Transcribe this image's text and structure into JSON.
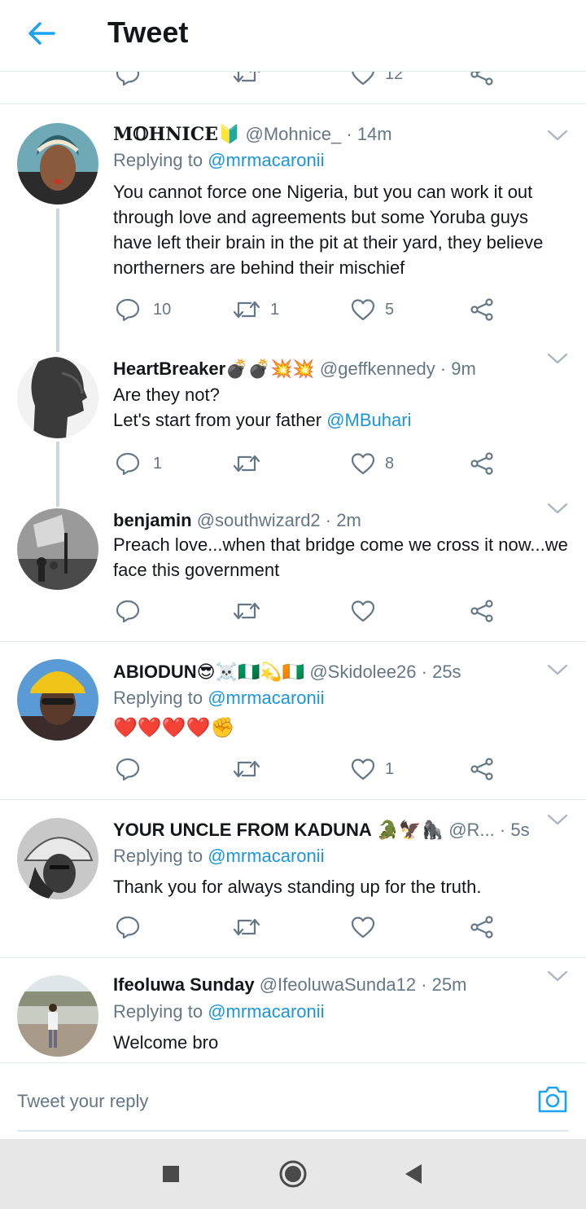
{
  "header": {
    "title": "Tweet"
  },
  "partial": {
    "like_count": "12"
  },
  "tweets": [
    {
      "name": "M𝕆HNICE",
      "name_emoji": "🔰",
      "handle": "@Mohnice_",
      "time": "· 14m",
      "replying_prefix": "Replying to",
      "replying_to": "@mrmacaronii",
      "text": "You cannot force one Nigeria, but you can work it out through love and agreements but some Yoruba guys have left their brain in the pit at their yard, they believe northerners are behind their mischief",
      "reply_count": "10",
      "retweet_count": "1",
      "like_count": "5"
    },
    {
      "name": "HeartBreaker",
      "name_emoji": "💣💣💥💥",
      "handle": "@geffkennedy",
      "time": "· 9m",
      "text_line1": "Are they not?",
      "text_line2_prefix": "Let's start from your father",
      "text_line2_mention": "@MBuhari",
      "reply_count": "1",
      "retweet_count": "",
      "like_count": "8"
    },
    {
      "name": "benjamin",
      "handle": "@southwizard2",
      "time": "· 2m",
      "text": "Preach love...when that bridge come we cross it now...we face this government",
      "reply_count": "",
      "retweet_count": "",
      "like_count": ""
    },
    {
      "name": "ABIODUN",
      "name_emoji": "😎☠️🇳🇬💫🇨🇮",
      "handle": "@Skidolee26",
      "time": "· 25s",
      "replying_prefix": "Replying to",
      "replying_to": "@mrmacaronii",
      "text": "❤️❤️❤️❤️✊",
      "reply_count": "",
      "retweet_count": "",
      "like_count": "1"
    },
    {
      "name": "YOUR UNCLE FROM KADUNA",
      "name_emoji": "🐊🦅🦍",
      "handle": "@R...",
      "time": "· 5s",
      "replying_prefix": "Replying to",
      "replying_to": "@mrmacaronii",
      "text": "Thank you for always standing up for the truth.",
      "reply_count": "",
      "retweet_count": "",
      "like_count": ""
    },
    {
      "name": "Ifeoluwa Sunday",
      "handle": "@IfeoluwaSunda12",
      "time": "· 25m",
      "replying_prefix": "Replying to",
      "replying_to": "@mrmacaronii",
      "text": "Welcome bro"
    }
  ],
  "reply_box": {
    "placeholder": "Tweet your reply"
  },
  "icons": {
    "back": "arrow-left-icon",
    "reply": "speech-bubble-icon",
    "retweet": "retweet-icon",
    "like": "heart-icon",
    "share": "share-icon",
    "chevron": "chevron-down-icon",
    "camera": "camera-icon",
    "nav_recents": "square-icon",
    "nav_home": "circle-icon",
    "nav_back": "triangle-back-icon"
  },
  "colors": {
    "accent": "#1da1f2",
    "link": "#1b95e0",
    "muted": "#657786",
    "text": "#14171a"
  }
}
